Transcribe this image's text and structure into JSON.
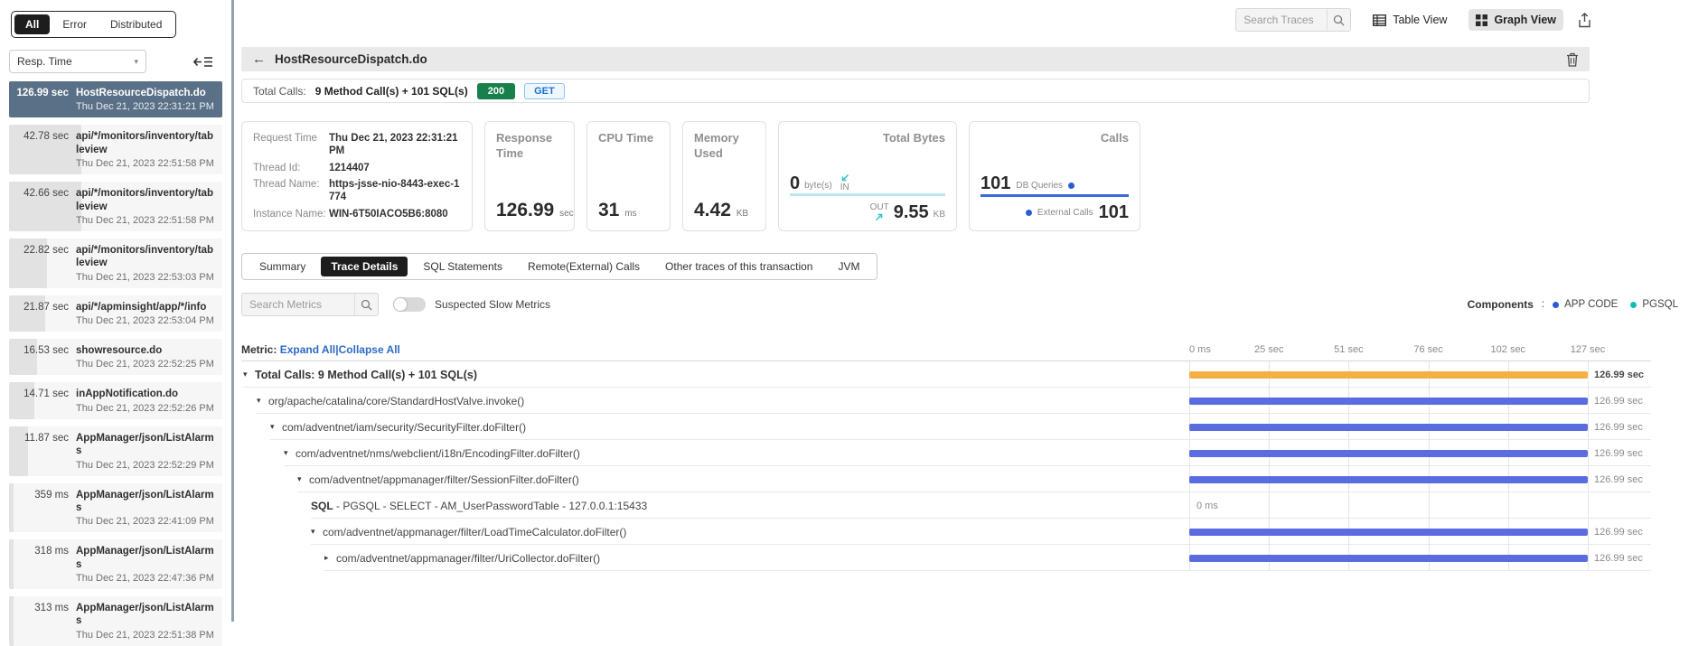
{
  "sidebar": {
    "filter_tabs": [
      {
        "label": "All",
        "active": true
      },
      {
        "label": "Error",
        "active": false
      },
      {
        "label": "Distributed",
        "active": false
      }
    ],
    "sort_dropdown": "Resp. Time",
    "traces": [
      {
        "duration": "126.99 sec",
        "name": "HostResourceDispatch.do",
        "time": "Thu Dec 21, 2023 22:31:21 PM",
        "pct": 100,
        "selected": true
      },
      {
        "duration": "42.78 sec",
        "name": "api/*/monitors/inventory/tableview",
        "time": "Thu Dec 21, 2023 22:51:58 PM",
        "pct": 34,
        "selected": false
      },
      {
        "duration": "42.66 sec",
        "name": "api/*/monitors/inventory/tableview",
        "time": "Thu Dec 21, 2023 22:51:58 PM",
        "pct": 34,
        "selected": false
      },
      {
        "duration": "22.82 sec",
        "name": "api/*/monitors/inventory/tableview",
        "time": "Thu Dec 21, 2023 22:53:03 PM",
        "pct": 18,
        "selected": false
      },
      {
        "duration": "21.87 sec",
        "name": "api/*/apminsight/app/*/info",
        "time": "Thu Dec 21, 2023 22:53:04 PM",
        "pct": 17,
        "selected": false
      },
      {
        "duration": "16.53 sec",
        "name": "showresource.do",
        "time": "Thu Dec 21, 2023 22:52:25 PM",
        "pct": 13,
        "selected": false
      },
      {
        "duration": "14.71 sec",
        "name": "inAppNotification.do",
        "time": "Thu Dec 21, 2023 22:52:26 PM",
        "pct": 12,
        "selected": false
      },
      {
        "duration": "11.87 sec",
        "name": "AppManager/json/ListAlarms",
        "time": "Thu Dec 21, 2023 22:52:29 PM",
        "pct": 9,
        "selected": false
      },
      {
        "duration": "359 ms",
        "name": "AppManager/json/ListAlarms",
        "time": "Thu Dec 21, 2023 22:41:09 PM",
        "pct": 2,
        "selected": false
      },
      {
        "duration": "318 ms",
        "name": "AppManager/json/ListAlarms",
        "time": "Thu Dec 21, 2023 22:47:36 PM",
        "pct": 2,
        "selected": false
      },
      {
        "duration": "313 ms",
        "name": "AppManager/json/ListAlarms",
        "time": "Thu Dec 21, 2023 22:51:38 PM",
        "pct": 2,
        "selected": false
      }
    ]
  },
  "toolbar": {
    "search_placeholder": "Search Traces",
    "table_view_label": "Table View",
    "graph_view_label": "Graph View"
  },
  "trace_header": {
    "title": "HostResourceDispatch.do",
    "total_calls_label": "Total Calls:",
    "total_calls_value": "9 Method Call(s) + 101 SQL(s)",
    "status_code": "200",
    "http_method": "GET"
  },
  "request_info": {
    "rows": [
      {
        "label": "Request Time",
        "value": "Thu Dec 21, 2023 22:31:21 PM"
      },
      {
        "label": "Thread Id:",
        "value": "1214407"
      },
      {
        "label": "Thread Name:",
        "value": "https-jsse-nio-8443-exec-1774"
      },
      {
        "label": "Instance Name:",
        "value": "WIN-6T50IACO5B6:8080"
      }
    ]
  },
  "stat_cards": {
    "response_time": {
      "title": "Response Time",
      "value": "126.99",
      "unit": "sec"
    },
    "cpu_time": {
      "title": "CPU Time",
      "value": "31",
      "unit": "ms"
    },
    "memory_used": {
      "title": "Memory Used",
      "value": "4.42",
      "unit": "KB"
    },
    "total_bytes": {
      "title": "Total Bytes",
      "in_value": "0",
      "in_unit": "byte(s)",
      "in_label": "IN",
      "out_label": "OUT",
      "out_value": "9.55",
      "out_unit": "KB"
    },
    "calls": {
      "title": "Calls",
      "db_value": "101",
      "db_label": "DB Queries",
      "ext_label": "External Calls",
      "ext_value": "101"
    }
  },
  "detail_tabs": [
    {
      "label": "Summary",
      "active": false
    },
    {
      "label": "Trace Details",
      "active": true
    },
    {
      "label": "SQL Statements",
      "active": false
    },
    {
      "label": "Remote(External) Calls",
      "active": false
    },
    {
      "label": "Other traces of this transaction",
      "active": false
    },
    {
      "label": "JVM",
      "active": false
    }
  ],
  "metrics_bar": {
    "search_placeholder": "Search Metrics",
    "toggle_label": "Suspected Slow Metrics",
    "components_label": "Components",
    "components": [
      {
        "name": "APP CODE",
        "color": "#2d5bd8"
      },
      {
        "name": "PGSQL",
        "color": "#14bdb4"
      }
    ]
  },
  "trace_tree": {
    "metric_label": "Metric:",
    "expand_all": "Expand All",
    "collapse_all": "Collapse All",
    "separator": "|",
    "axis_ticks": [
      "0 ms",
      "25 sec",
      "51 sec",
      "76 sec",
      "102 sec",
      "127 sec"
    ],
    "rows": [
      {
        "label": "Total Calls: 9 Method Call(s) + 101 SQL(s)",
        "depth": 0,
        "expander": "expanded",
        "bold": true,
        "bar_pct": 100,
        "bar_color": "#f4b042",
        "value": "126.99 sec",
        "value_align": "right"
      },
      {
        "label": "org/apache/catalina/core/StandardHostValve.invoke()",
        "depth": 1,
        "expander": "expanded",
        "bold": false,
        "bar_pct": 100,
        "bar_color": "#5b6ce0",
        "value": "126.99 sec",
        "value_align": "right"
      },
      {
        "label": "com/adventnet/iam/security/SecurityFilter.doFilter()",
        "depth": 2,
        "expander": "expanded",
        "bold": false,
        "bar_pct": 100,
        "bar_color": "#5b6ce0",
        "value": "126.99 sec",
        "value_align": "right"
      },
      {
        "label": "com/adventnet/nms/webclient/i18n/EncodingFilter.doFilter()",
        "depth": 3,
        "expander": "expanded",
        "bold": false,
        "bar_pct": 100,
        "bar_color": "#5b6ce0",
        "value": "126.99 sec",
        "value_align": "right"
      },
      {
        "label": "com/adventnet/appmanager/filter/SessionFilter.doFilter()",
        "depth": 4,
        "expander": "expanded",
        "bold": false,
        "bar_pct": 100,
        "bar_color": "#5b6ce0",
        "value": "126.99 sec",
        "value_align": "right"
      },
      {
        "label_bold": "SQL",
        "label": " - PGSQL - SELECT - AM_UserPasswordTable - 127.0.0.1:15433",
        "depth": 5,
        "expander": "none",
        "bold": false,
        "bar_pct": 0,
        "bar_color": "",
        "value": "0 ms",
        "value_align": "left"
      },
      {
        "label": "com/adventnet/appmanager/filter/LoadTimeCalculator.doFilter()",
        "depth": 5,
        "expander": "expanded",
        "bold": false,
        "bar_pct": 100,
        "bar_color": "#5b6ce0",
        "value": "126.99 sec",
        "value_align": "right"
      },
      {
        "label": "com/adventnet/appmanager/filter/UriCollector.doFilter()",
        "depth": 6,
        "expander": "collapsed",
        "bold": false,
        "bar_pct": 100,
        "bar_color": "#5b6ce0",
        "value": "126.99 sec",
        "value_align": "right"
      }
    ]
  }
}
